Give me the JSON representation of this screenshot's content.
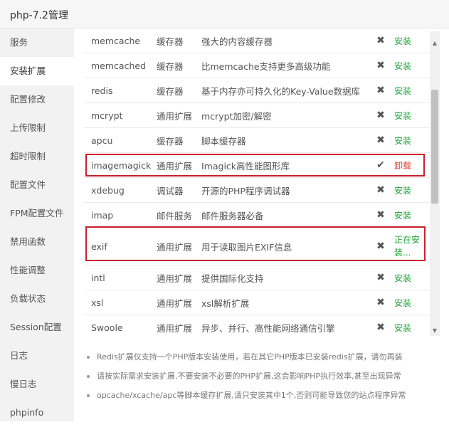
{
  "window": {
    "title": "php-7.2管理"
  },
  "sidebar": {
    "items": [
      {
        "label": "服务"
      },
      {
        "label": "安装扩展"
      },
      {
        "label": "配置修改"
      },
      {
        "label": "上传限制"
      },
      {
        "label": "超时限制"
      },
      {
        "label": "配置文件"
      },
      {
        "label": "FPM配置文件"
      },
      {
        "label": "禁用函数"
      },
      {
        "label": "性能调整"
      },
      {
        "label": "负载状态"
      },
      {
        "label": "Session配置"
      },
      {
        "label": "日志"
      },
      {
        "label": "慢日志"
      },
      {
        "label": "phpinfo"
      }
    ],
    "active_index": 1
  },
  "extensions": [
    {
      "name": "memcache",
      "type": "缓存器",
      "desc": "强大的内容缓存器",
      "status_icon": "✖",
      "installed": false,
      "action": "安装"
    },
    {
      "name": "memcached",
      "type": "缓存器",
      "desc": "比memcache支持更多高级功能",
      "status_icon": "✖",
      "installed": false,
      "action": "安装"
    },
    {
      "name": "redis",
      "type": "缓存器",
      "desc": "基于内存亦可持久化的Key-Value数据库",
      "status_icon": "✖",
      "installed": false,
      "action": "安装"
    },
    {
      "name": "mcrypt",
      "type": "通用扩展",
      "desc": "mcrypt加密/解密",
      "status_icon": "✖",
      "installed": false,
      "action": "安装"
    },
    {
      "name": "apcu",
      "type": "缓存器",
      "desc": "脚本缓存器",
      "status_icon": "✖",
      "installed": false,
      "action": "安装"
    },
    {
      "name": "imagemagick",
      "type": "通用扩展",
      "desc": "Imagick高性能图形库",
      "status_icon": "✔",
      "installed": true,
      "action": "卸载"
    },
    {
      "name": "xdebug",
      "type": "调试器",
      "desc": "开源的PHP程序调试器",
      "status_icon": "✖",
      "installed": false,
      "action": "安装"
    },
    {
      "name": "imap",
      "type": "邮件服务",
      "desc": "邮件服务器必备",
      "status_icon": "✖",
      "installed": false,
      "action": "安装"
    },
    {
      "name": "exif",
      "type": "通用扩展",
      "desc": "用于读取图片EXIF信息",
      "status_icon": "✖",
      "installed": false,
      "action": "正在安装..."
    },
    {
      "name": "intl",
      "type": "通用扩展",
      "desc": "提供国际化支持",
      "status_icon": "✖",
      "installed": false,
      "action": "安装"
    },
    {
      "name": "xsl",
      "type": "通用扩展",
      "desc": "xsl解析扩展",
      "status_icon": "✖",
      "installed": false,
      "action": "安装"
    },
    {
      "name": "Swoole",
      "type": "通用扩展",
      "desc": "异步、并行、高性能网络通信引擎",
      "status_icon": "✖",
      "installed": false,
      "action": "安装"
    }
  ],
  "notes": [
    "Redis扩展仅支持一个PHP版本安装使用，若在其它PHP版本已安装redis扩展，请勿再装",
    "请按实际需求安装扩展,不要安装不必要的PHP扩展,这会影响PHP执行效率,甚至出现异常",
    "opcache/xcache/apc等脚本缓存扩展,请只安装其中1个,否则可能导致您的站点程序异常"
  ],
  "colors": {
    "install": "#20a53a",
    "uninstall": "#e03e2d",
    "highlight_box": "#c9202b"
  }
}
